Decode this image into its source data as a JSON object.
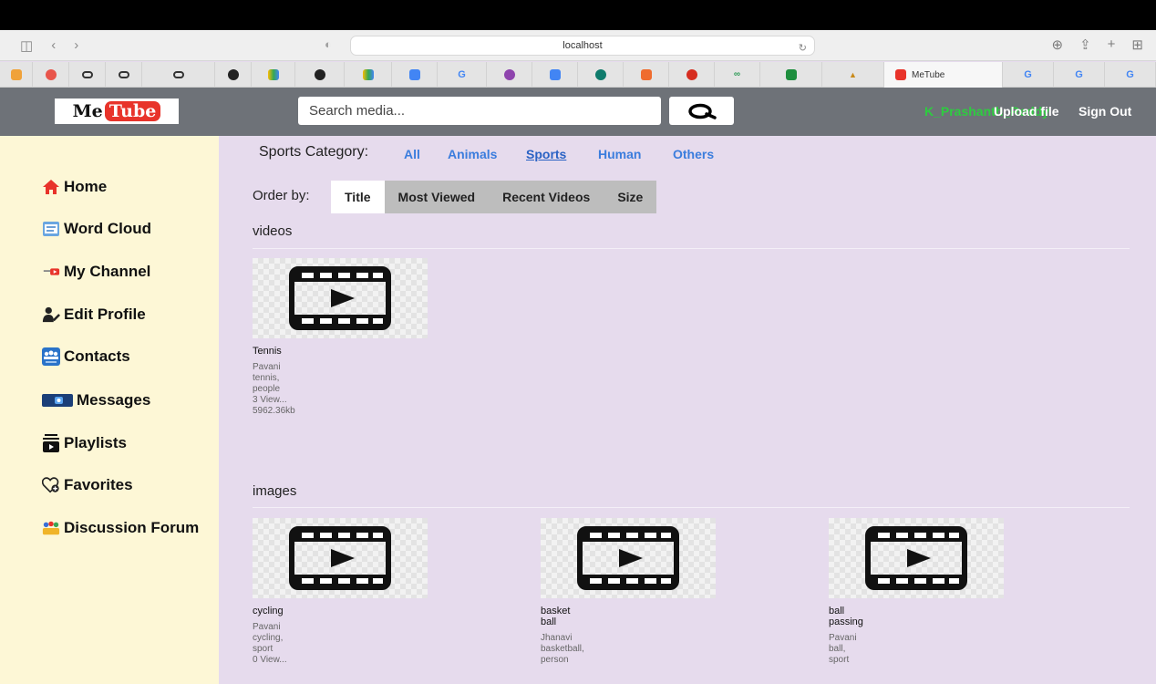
{
  "browser": {
    "address": "localhost",
    "active_tab_title": "MeTube"
  },
  "header": {
    "logo_me": "Me",
    "logo_tube": "Tube",
    "search_placeholder": "Search media...",
    "username": "K_Prashanth_Reddy",
    "upload_label": "Upload file",
    "signout_label": "Sign Out"
  },
  "sidebar": {
    "items": [
      {
        "label": "Home",
        "icon": "home-icon"
      },
      {
        "label": "Word Cloud",
        "icon": "word-cloud-icon"
      },
      {
        "label": "My Channel",
        "icon": "youtube-icon"
      },
      {
        "label": "Edit Profile",
        "icon": "edit-profile-icon"
      },
      {
        "label": "Contacts",
        "icon": "contacts-icon"
      },
      {
        "label": "Messages",
        "icon": "messages-icon"
      },
      {
        "label": "Playlists",
        "icon": "playlist-icon"
      },
      {
        "label": "Favorites",
        "icon": "favorites-icon"
      },
      {
        "label": "Discussion Forum",
        "icon": "forum-icon"
      }
    ]
  },
  "category": {
    "label": "Sports Category:",
    "links": [
      "All",
      "Animals",
      "Sports",
      "Human",
      "Others"
    ],
    "active": "Sports"
  },
  "order": {
    "label": "Order by:",
    "tabs": [
      "Title",
      "Most Viewed",
      "Recent Videos",
      "Size"
    ],
    "active": "Title"
  },
  "videos": {
    "title": "videos",
    "items": [
      {
        "title": "Tennis",
        "author": "Pavani",
        "tags": [
          "tennis,",
          "people"
        ],
        "views": "3 View...",
        "size": "5962.36kb"
      }
    ]
  },
  "images": {
    "title": "images",
    "items": [
      {
        "title": "cycling",
        "author": "Pavani",
        "tags": [
          "cycling,",
          "sport"
        ],
        "views": "0 View..."
      },
      {
        "title": "basket ball",
        "author": "Jhanavi",
        "tags": [
          "basketball,",
          "person"
        ]
      },
      {
        "title": "ball passing",
        "author": "Pavani",
        "tags": [
          "ball,",
          "sport"
        ]
      }
    ]
  },
  "colors": {
    "header_bg": "#6e7278",
    "sidebar_bg": "#fdf7d6",
    "main_bg": "#e6dbed",
    "link_blue": "#3b7ddd",
    "username_green": "#2ecc40"
  }
}
